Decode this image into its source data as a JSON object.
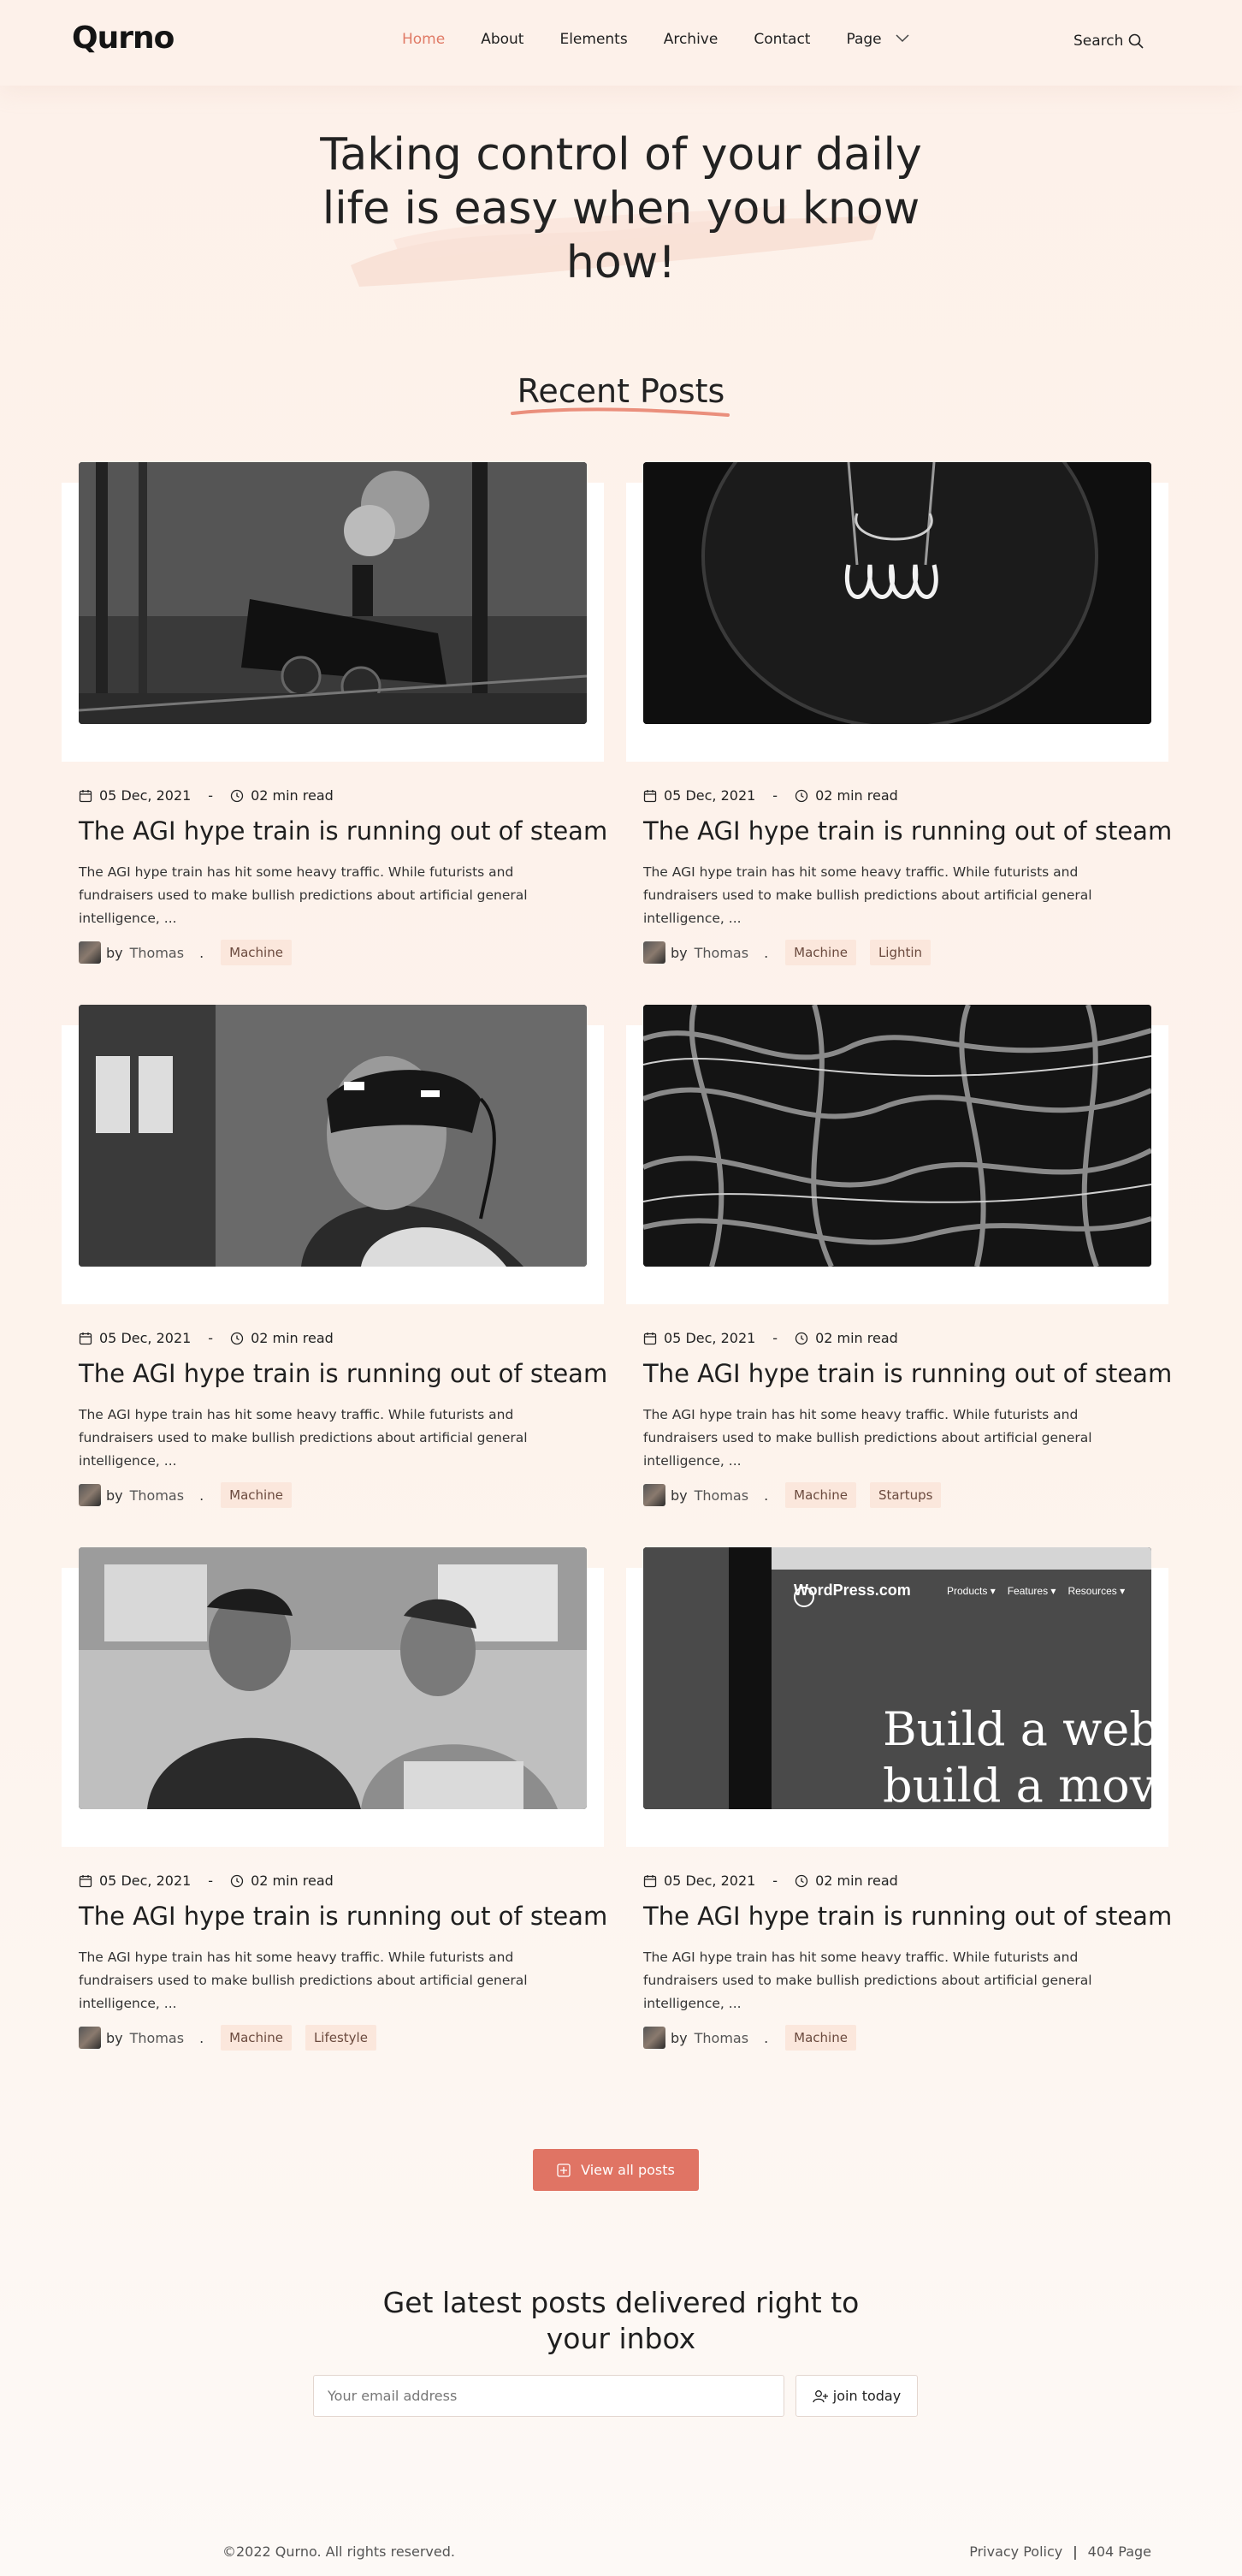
{
  "header": {
    "logo": "Qurno",
    "nav": [
      {
        "label": "Home",
        "active": true
      },
      {
        "label": "About"
      },
      {
        "label": "Elements"
      },
      {
        "label": "Archive"
      },
      {
        "label": "Contact"
      },
      {
        "label": "Page"
      }
    ],
    "search_label": "Search"
  },
  "hero": {
    "title": "Taking control of your daily life is easy when you know how!"
  },
  "recent": {
    "title": "Recent Posts"
  },
  "posts": [
    {
      "image": "steam-train-photo",
      "date": "05 Dec, 2021",
      "read": "02 min read",
      "title": "The AGI hype train is running out of steam",
      "excerpt": "The AGI hype train has hit some heavy traffic. While futurists and fundraisers used to make bullish predictions about artificial general intelligence, ...",
      "by": "by",
      "author": "Thomas",
      "tags": [
        "Machine"
      ]
    },
    {
      "image": "light-bulb-photo",
      "date": "05 Dec, 2021",
      "read": "02 min read",
      "title": "The AGI hype train is running out of steam",
      "excerpt": "The AGI hype train has hit some heavy traffic. While futurists and fundraisers used to make bullish predictions about artificial general intelligence, ...",
      "by": "by",
      "author": "Thomas",
      "tags": [
        "Machine",
        "Lightin"
      ]
    },
    {
      "image": "vr-headset-photo",
      "date": "05 Dec, 2021",
      "read": "02 min read",
      "title": "The AGI hype train is running out of steam",
      "excerpt": "The AGI hype train has hit some heavy traffic. While futurists and fundraisers used to make bullish predictions about artificial general intelligence, ...",
      "by": "by",
      "author": "Thomas",
      "tags": [
        "Machine"
      ]
    },
    {
      "image": "cables-photo",
      "date": "05 Dec, 2021",
      "read": "02 min read",
      "title": "The AGI hype train is running out of steam",
      "excerpt": "The AGI hype train has hit some heavy traffic. While futurists and fundraisers used to make bullish predictions about artificial general intelligence, ...",
      "by": "by",
      "author": "Thomas",
      "tags": [
        "Machine",
        "Startups"
      ]
    },
    {
      "image": "two-men-photo",
      "date": "05 Dec, 2021",
      "read": "02 min read",
      "title": "The AGI hype train is running out of steam",
      "excerpt": "The AGI hype train has hit some heavy traffic. While futurists and fundraisers used to make bullish predictions about artificial general intelligence, ...",
      "by": "by",
      "author": "Thomas",
      "tags": [
        "Machine",
        "Lifestyle"
      ]
    },
    {
      "image": "wordpress-screen-photo",
      "date": "05 Dec, 2021",
      "read": "02 min read",
      "title": "The AGI hype train is running out of steam",
      "excerpt": "The AGI hype train has hit some heavy traffic. While futurists and fundraisers used to make bullish predictions about artificial general intelligence, ...",
      "by": "by",
      "author": "Thomas",
      "tags": [
        "Machine"
      ]
    }
  ],
  "wp_screen": {
    "brand": "WordPress.com",
    "menu": [
      "Products ▾",
      "Features ▾",
      "Resources ▾"
    ],
    "headline_1": "Build a webs",
    "headline_2": "build a move"
  },
  "view_all_label": "View all posts",
  "newsletter": {
    "title": "Get latest posts delivered right to your inbox",
    "email_placeholder": "Your email address",
    "join_label": "join today"
  },
  "footer": {
    "copyright": "©2022 Qurno. All rights reserved.",
    "links": [
      "Privacy Policy",
      "404 Page"
    ],
    "separator": "|"
  },
  "colors": {
    "accent": "#e07464",
    "background": "#fdf1ea",
    "tag_bg": "#fbe7dc"
  }
}
